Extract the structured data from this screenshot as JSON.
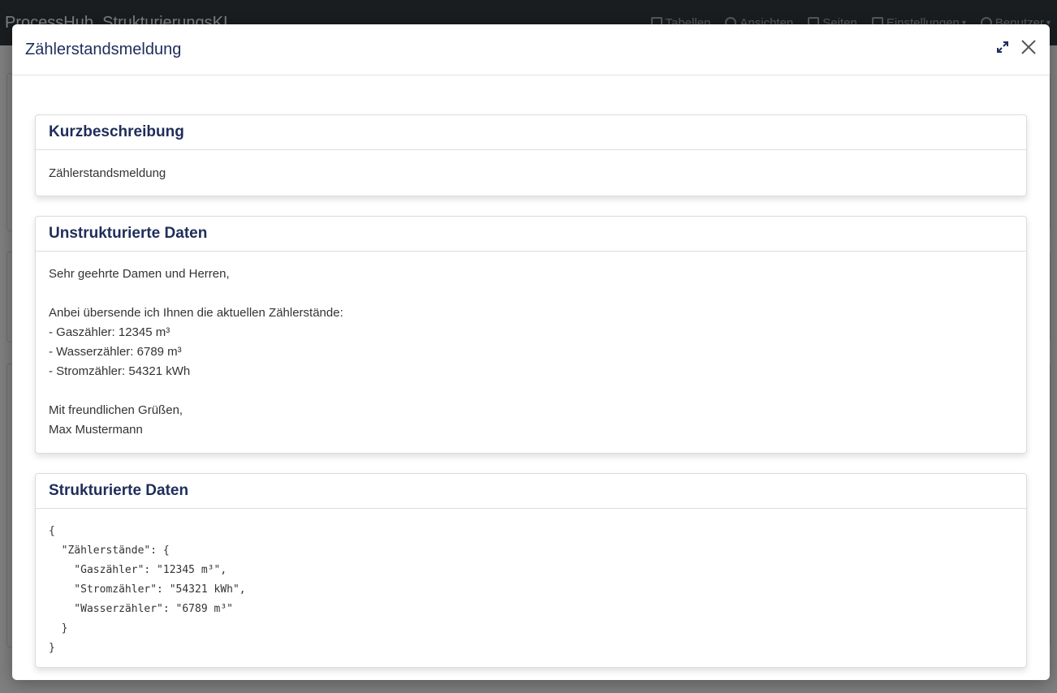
{
  "navbar": {
    "brand": "ProcessHub",
    "subtitle": "StrukturierungsKI",
    "links": [
      {
        "label": "Tabellen",
        "icon": "table-icon"
      },
      {
        "label": "Ansichten",
        "icon": "eye-icon"
      },
      {
        "label": "Seiten",
        "icon": "file-icon"
      },
      {
        "label": "Einstellungen",
        "icon": "wrench-icon"
      },
      {
        "label": "Benutzer",
        "icon": "user-icon"
      }
    ]
  },
  "modal": {
    "title": "Zählerstandsmeldung",
    "expand_icon": "expand-icon",
    "close_icon": "close-icon",
    "cards": {
      "kurzbeschreibung": {
        "title": "Kurzbeschreibung",
        "text": "Zählerstandsmeldung"
      },
      "unstrukturiert": {
        "title": "Unstrukturierte Daten",
        "lines": [
          "Sehr geehrte Damen und Herren,",
          "",
          "Anbei übersende ich Ihnen die aktuellen Zählerstände:",
          "- Gaszähler: 12345 m³",
          "- Wasserzähler: 6789 m³",
          "- Stromzähler: 54321 kWh",
          "",
          "Mit freundlichen Grüßen,",
          "Max Mustermann"
        ]
      },
      "strukturiert": {
        "title": "Strukturierte Daten",
        "json_lines": [
          "{",
          "  \"Zählerstände\": {",
          "    \"Gaszähler\": \"12345 m³\",",
          "    \"Stromzähler\": \"54321 kWh\",",
          "    \"Wasserzähler\": \"6789 m³\"",
          "  }",
          "}"
        ]
      }
    }
  },
  "colors": {
    "title": "#1f2d5a",
    "navbar": "#343a40"
  }
}
